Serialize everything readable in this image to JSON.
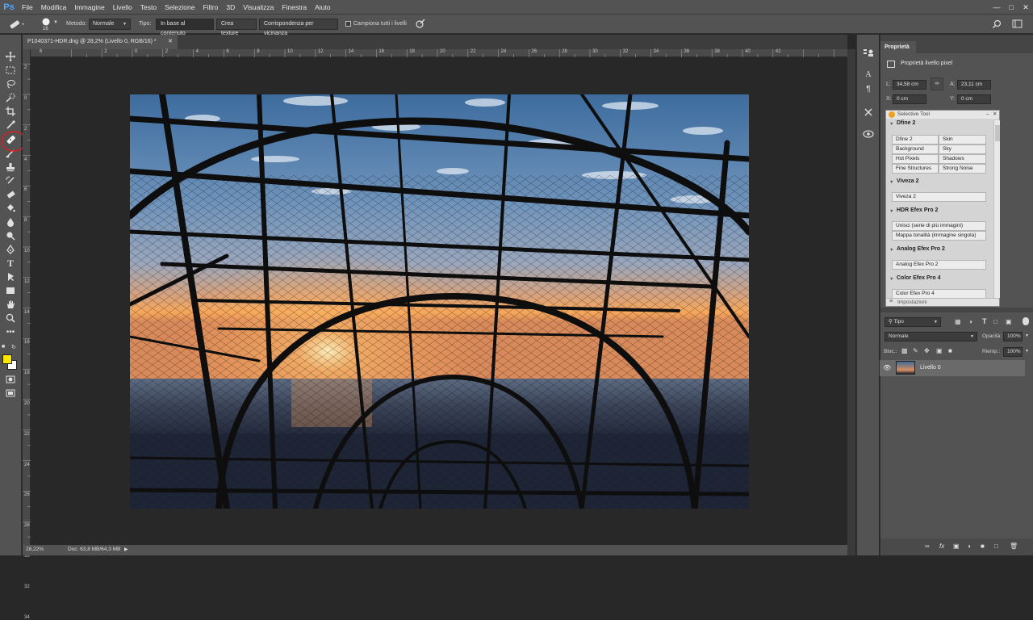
{
  "app": {
    "logo": "Ps",
    "menu": [
      "File",
      "Modifica",
      "Immagine",
      "Livello",
      "Testo",
      "Selezione",
      "Filtro",
      "3D",
      "Visualizza",
      "Finestra",
      "Aiuto"
    ],
    "window_controls": [
      "minimize-icon",
      "maximize-icon",
      "close-icon"
    ]
  },
  "options_bar": {
    "brush_size": "16",
    "method_label": "Metodo:",
    "method_value": "Normale",
    "type_label": "Tipo:",
    "type_buttons": [
      "In base al contenuto",
      "Crea texture",
      "Corrispondenza per vicinanza"
    ],
    "sample_all_label": "Campiona tutti i livelli"
  },
  "document": {
    "tab_title": "P1040371-HDR.dng @ 28,2% (Livello 0, RGB/16) *",
    "ruler_h": [
      "2",
      "0",
      "2",
      "4",
      "6",
      "8",
      "10",
      "12",
      "14",
      "16",
      "18",
      "20",
      "22",
      "24",
      "26",
      "28",
      "30",
      "32",
      "34",
      "36",
      "38",
      "40",
      "42"
    ],
    "ruler_h_start": "6",
    "ruler_v": [
      "2",
      "0",
      "2",
      "4",
      "6",
      "8",
      "10",
      "12",
      "14",
      "16",
      "18",
      "20",
      "22",
      "24",
      "26",
      "28",
      "30",
      "32",
      "34"
    ],
    "zoom": "28,22%",
    "doc_size": "Doc: 63,8 MB/64,3 MB"
  },
  "properties": {
    "tab_label": "Proprietà",
    "header": "Proprietà livello pixel",
    "w_label": "L:",
    "w_value": "34,58 cm",
    "h_label": "A:",
    "h_value": "23,11 cm",
    "x_label": "X:",
    "x_value": "0 cm",
    "y_label": "Y:",
    "y_value": "0 cm"
  },
  "selective_tool": {
    "title": "Selective Tool",
    "sections": [
      {
        "name": "Dfine 2",
        "buttons": [
          "Dfine 2",
          "Skin",
          "Background",
          "Sky",
          "Hot Pixels",
          "Shadows",
          "Fine Structures",
          "Strong Noise"
        ]
      },
      {
        "name": "Viveza 2",
        "buttons": [
          "Viveza 2"
        ]
      },
      {
        "name": "HDR Efex Pro 2",
        "buttons": [
          "Unisci (serie di più immagini)",
          "Mappa tonalità (immagine singola)"
        ]
      },
      {
        "name": "Analog Efex Pro 2",
        "buttons": [
          "Analog Efex Pro 2"
        ]
      },
      {
        "name": "Color Efex Pro 4",
        "buttons": [
          "Color Efex Pro 4"
        ]
      }
    ],
    "settings_label": "Impostazioni"
  },
  "layers": {
    "filter_label": "Tipo",
    "blend_mode": "Normale",
    "opacity_label": "Opacità:",
    "opacity_value": "100%",
    "lock_label": "Bloc.:",
    "fill_label": "Riemp.:",
    "fill_value": "100%",
    "layer_name": "Livello 0",
    "bottom_icons": [
      "link-icon",
      "fx-icon",
      "mask-icon",
      "adjustment-icon",
      "folder-icon",
      "new-layer-icon",
      "trash-icon"
    ]
  },
  "colors": {
    "foreground": "#ffe600",
    "background": "#ffffff",
    "annotation": "#d42020"
  }
}
